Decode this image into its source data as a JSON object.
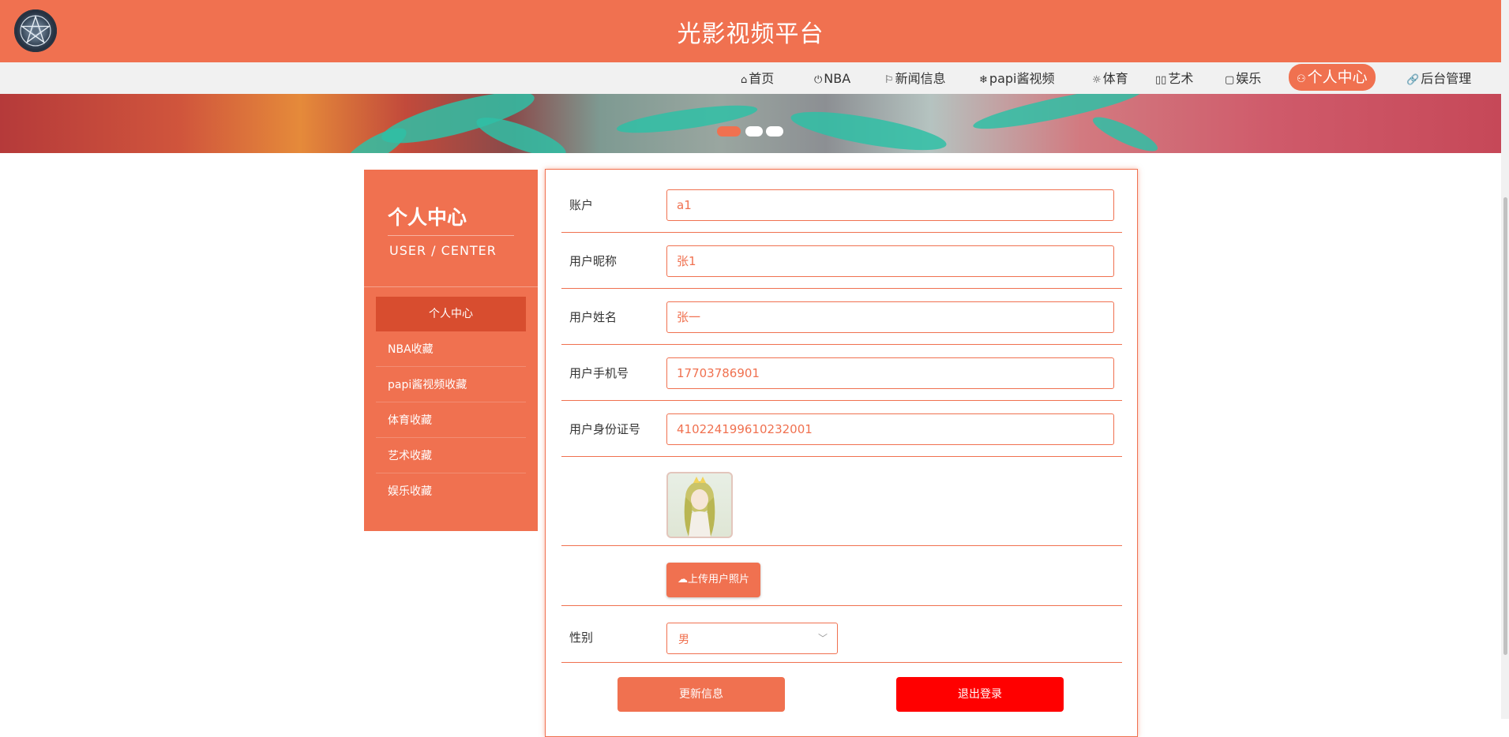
{
  "header": {
    "site_title": "光影视频平台",
    "logo_icon": "pentagram-logo-icon",
    "bg_color": "#f07150"
  },
  "nav": {
    "items": [
      {
        "icon": "home-icon",
        "glyph": "⌂",
        "label": "首页"
      },
      {
        "icon": "power-icon",
        "glyph": "⏻",
        "label": "NBA"
      },
      {
        "icon": "flag-icon",
        "glyph": "⚐",
        "label": "新闻信息"
      },
      {
        "icon": "snowflake-icon",
        "glyph": "❄",
        "label": "papi酱视频"
      },
      {
        "icon": "sun-icon",
        "glyph": "☼",
        "label": "体育"
      },
      {
        "icon": "book-icon",
        "glyph": "▯▯",
        "label": "艺术"
      },
      {
        "icon": "note-icon",
        "glyph": "▢",
        "label": "娱乐"
      },
      {
        "icon": "user-icon",
        "glyph": "⚇",
        "label": "个人中心"
      },
      {
        "icon": "link-icon",
        "glyph": "🔗",
        "label": "后台管理"
      }
    ],
    "active_label": "个人中心"
  },
  "banner": {
    "carousel_dots": 3,
    "active_dot": 1
  },
  "sidebar": {
    "title": "个人中心",
    "subtitle": "USER / CENTER",
    "items": [
      {
        "label": "个人中心"
      },
      {
        "label": "NBA收藏"
      },
      {
        "label": "papi酱视频收藏"
      },
      {
        "label": "体育收藏"
      },
      {
        "label": "艺术收藏"
      },
      {
        "label": "娱乐收藏"
      }
    ]
  },
  "form": {
    "account": {
      "label": "账户",
      "value": "a1"
    },
    "nickname": {
      "label": "用户昵称",
      "value": "张1"
    },
    "name": {
      "label": "用户姓名",
      "value": "张一"
    },
    "phone": {
      "label": "用户手机号",
      "value": "17703786901"
    },
    "id_card": {
      "label": "用户身份证号",
      "value": "410224199610232001"
    },
    "upload_label": "上传用户照片",
    "upload_icon": "cloud-upload-icon",
    "gender": {
      "label": "性别",
      "value": "男"
    },
    "update_button": "更新信息",
    "logout_button": "退出登录"
  },
  "colors": {
    "accent": "#f07150",
    "accent_dark": "#d84d2f",
    "danger": "#ff0000",
    "nav_bg": "#f1f1f1"
  }
}
